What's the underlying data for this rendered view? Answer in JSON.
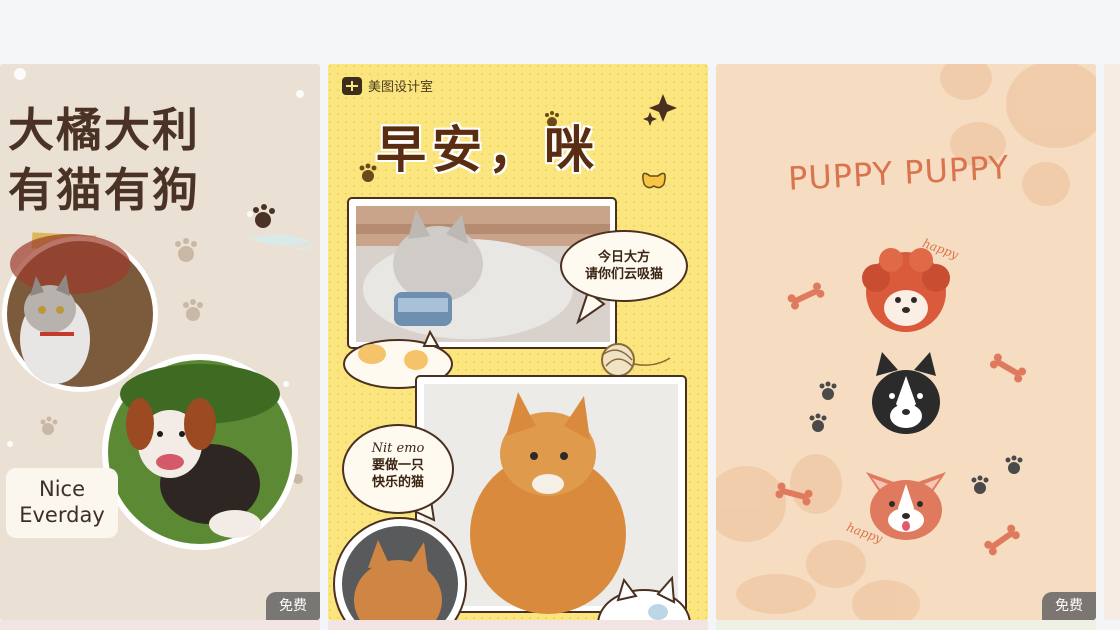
{
  "templates": [
    {
      "title_lines": [
        "大橘大利",
        "有猫有狗"
      ],
      "caption_lines": [
        "Nice",
        "Everday"
      ],
      "badge": "免费"
    },
    {
      "brand": "美图设计室",
      "title": "早安，咪",
      "bubble1_lines": [
        "今日大方",
        "请你们云吸猫"
      ],
      "bubble2_lines": [
        "Nit emo",
        "要做一只",
        "快乐的猫"
      ]
    },
    {
      "title": "PUPPY PUPPY",
      "happy_top": "happy",
      "happy_bottom": "happy",
      "badge": "免费"
    }
  ],
  "colors": {
    "card1_bg": "#eae0d3",
    "card2_bg": "#fbe57e",
    "card3_bg": "#f6dcc0",
    "badge_bg": "#5f5f5f"
  }
}
